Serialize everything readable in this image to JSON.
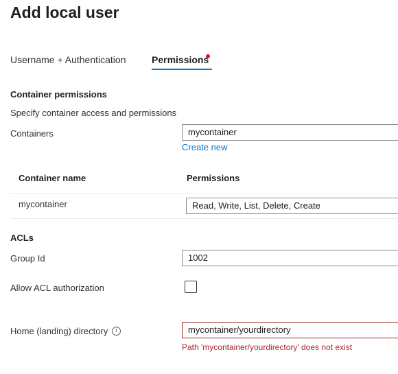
{
  "page": {
    "title": "Add local user"
  },
  "tabs": [
    {
      "label": "Username + Authentication",
      "active": false
    },
    {
      "label": "Permissions",
      "active": true,
      "indicator": "error-dot"
    }
  ],
  "container_permissions": {
    "heading": "Container permissions",
    "description": "Specify container access and permissions",
    "containers_label": "Containers",
    "containers_value": "mycontainer",
    "create_new_label": "Create new"
  },
  "table": {
    "columns": [
      "Container name",
      "Permissions"
    ],
    "rows": [
      {
        "container": "mycontainer",
        "permissions": "Read, Write, List, Delete, Create"
      }
    ]
  },
  "acls": {
    "heading": "ACLs",
    "group_id_label": "Group Id",
    "group_id_value": "1002",
    "allow_acl_label": "Allow ACL authorization",
    "allow_acl_checked": false
  },
  "home": {
    "label": "Home (landing) directory",
    "info_icon": "info-icon",
    "value": "mycontainer/yourdirectory",
    "error": "Path 'mycontainer/yourdirectory' does not exist"
  },
  "colors": {
    "accent": "#0078d4",
    "error": "#a4262c",
    "error_dot": "#e81123",
    "text": "#323130"
  }
}
